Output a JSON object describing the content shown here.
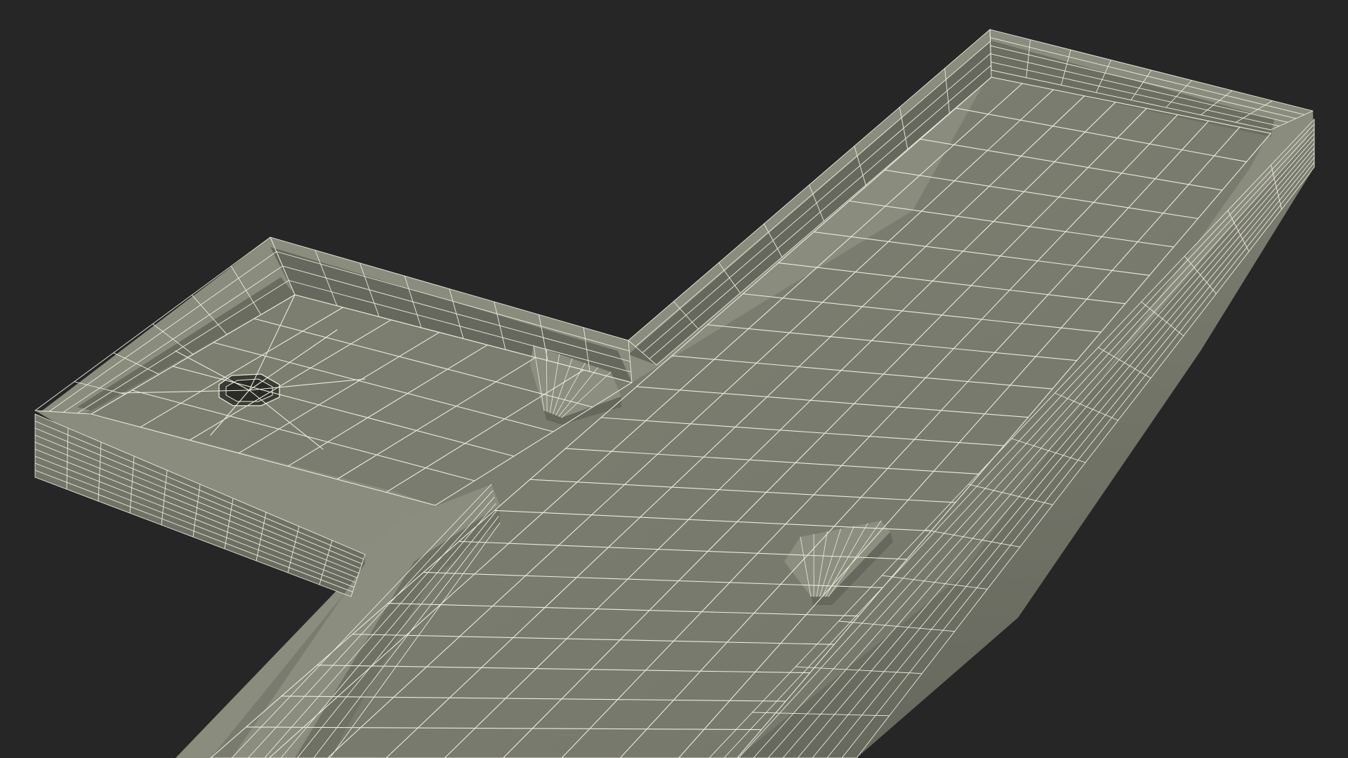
{
  "scene": {
    "subject": "",
    "colors": {
      "background": "#262626",
      "surface": "#787a6c",
      "surface_light": "#858778",
      "surface_dark": "#5e6055",
      "rim_top": "#8a8c7e",
      "rim_side": "#6d6f63",
      "wire": "#ecebdd"
    }
  }
}
